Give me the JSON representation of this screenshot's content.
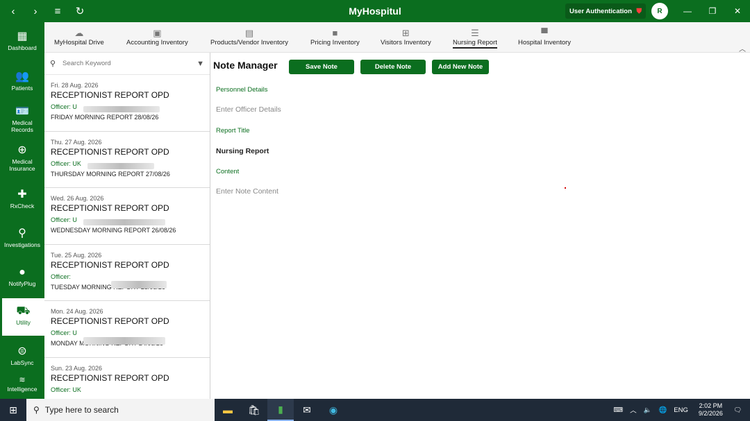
{
  "titlebar": {
    "app_title": "MyHospitul",
    "auth_label": "User Authentication",
    "avatar_initial": "R"
  },
  "sidebar": {
    "items": [
      {
        "label": "Dashboard",
        "icon": "dashboard-icon"
      },
      {
        "label": "Patients",
        "icon": "patients-icon"
      },
      {
        "label": "Medical Records",
        "icon": "records-icon"
      },
      {
        "label": "Medical Insurance",
        "icon": "insurance-icon"
      },
      {
        "label": "RxCheck",
        "icon": "rx-icon"
      },
      {
        "label": "Investigations",
        "icon": "investigations-icon"
      },
      {
        "label": "NotifyPlug",
        "icon": "notify-icon"
      },
      {
        "label": "Utility",
        "icon": "utility-icon"
      },
      {
        "label": "LabSync",
        "icon": "labsync-icon"
      },
      {
        "label": "Intelligence",
        "icon": "intelligence-icon"
      }
    ]
  },
  "tabs": [
    {
      "label": "MyHospital Drive"
    },
    {
      "label": "Accounting Inventory"
    },
    {
      "label": "Products/Vendor Inventory"
    },
    {
      "label": "Pricing Inventory"
    },
    {
      "label": "Visitors Inventory"
    },
    {
      "label": "Nursing Report"
    },
    {
      "label": "Hospital Inventory"
    }
  ],
  "list": {
    "search_placeholder": "Search Keyword",
    "items": [
      {
        "date": "Fri. 28 Aug. 2026",
        "title": "RECEPTIONIST REPORT OPD",
        "officer": "Officer: U",
        "subtitle": "FRIDAY MORNING REPORT 28/08/26"
      },
      {
        "date": "Thu. 27 Aug. 2026",
        "title": "RECEPTIONIST REPORT OPD",
        "officer": "Officer: UK",
        "subtitle": "THURSDAY MORNING REPORT 27/08/26"
      },
      {
        "date": "Wed. 26 Aug. 2026",
        "title": "RECEPTIONIST REPORT OPD",
        "officer": "Officer: U",
        "subtitle": "WEDNESDAY MORNING REPORT 26/08/26"
      },
      {
        "date": "Tue. 25 Aug. 2026",
        "title": "RECEPTIONIST REPORT OPD",
        "officer": "Officer:",
        "subtitle": "TUESDAY MORNING REPORT 25/08/26"
      },
      {
        "date": "Mon. 24 Aug. 2026",
        "title": "RECEPTIONIST REPORT OPD",
        "officer": "Officer: U",
        "subtitle": "MONDAY MORNING REPORT 24/08/26"
      },
      {
        "date": "Sun. 23 Aug. 2026",
        "title": "RECEPTIONIST REPORT OPD",
        "officer": "Officer: UK",
        "subtitle": ""
      }
    ]
  },
  "note_manager": {
    "title": "Note Manager",
    "save_label": "Save Note",
    "delete_label": "Delete Note",
    "add_label": "Add New Note",
    "personnel_label": "Personnel Details",
    "personnel_placeholder": "Enter Officer Details",
    "report_title_label": "Report Title",
    "report_title_value": "Nursing Report",
    "content_label": "Content",
    "content_placeholder": "Enter Note Content"
  },
  "taskbar": {
    "search_placeholder": "Type here to search",
    "language": "ENG",
    "time": "2:02 PM",
    "date": "9/2/2026"
  },
  "colors": {
    "brand_green": "#0b6e1f",
    "taskbar_bg": "#1f2a38"
  }
}
